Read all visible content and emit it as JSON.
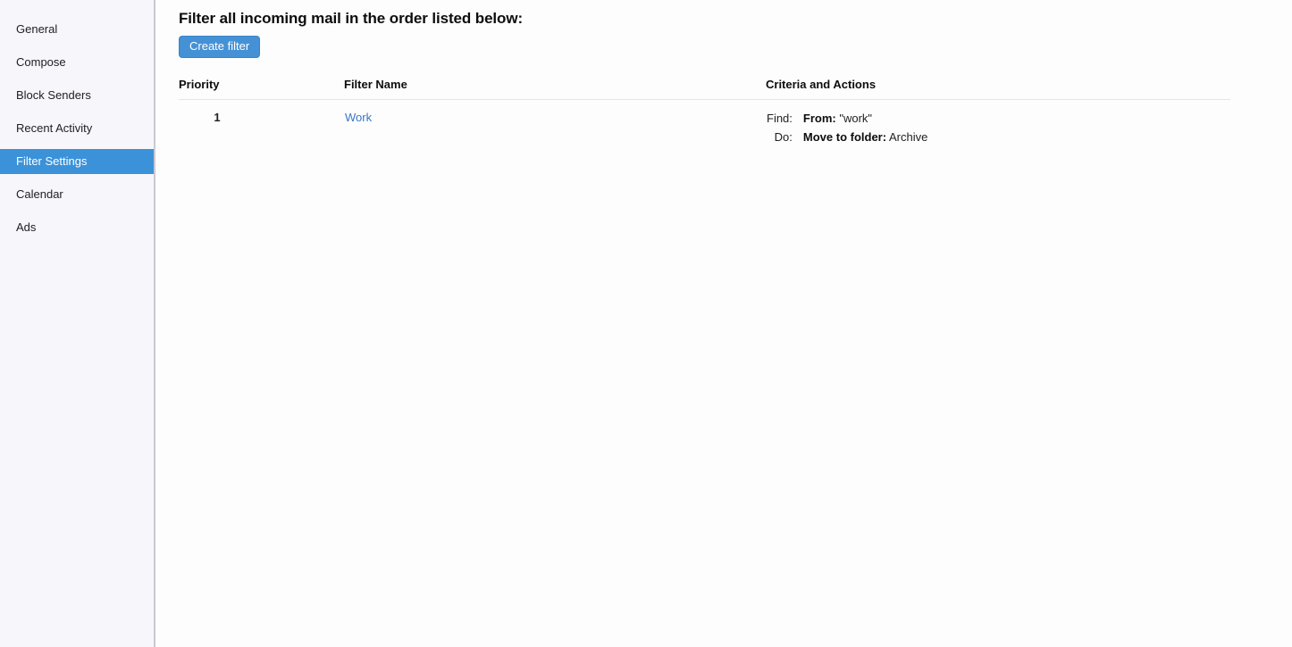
{
  "sidebar": {
    "items": [
      {
        "label": "General",
        "selected": false
      },
      {
        "label": "Compose",
        "selected": false
      },
      {
        "label": "Block Senders",
        "selected": false
      },
      {
        "label": "Recent Activity",
        "selected": false
      },
      {
        "label": "Filter Settings",
        "selected": true
      },
      {
        "label": "Calendar",
        "selected": false
      },
      {
        "label": "Ads",
        "selected": false
      }
    ]
  },
  "main": {
    "title": "Filter all incoming mail in the order listed below:",
    "create_filter_label": "Create filter",
    "table": {
      "headers": {
        "priority": "Priority",
        "filter_name": "Filter Name",
        "criteria_and_actions": "Criteria and Actions"
      },
      "rows": [
        {
          "priority": "1",
          "filter_name": "Work",
          "criteria": {
            "find_label": "Find:",
            "find_field": "From:",
            "find_value": "\"work\"",
            "do_label": "Do:",
            "do_action": "Move to folder:",
            "do_value": "Archive"
          }
        }
      ]
    }
  },
  "colors": {
    "accent_blue": "#3b92d8",
    "button_blue": "#4591d6",
    "link_blue": "#3a76c4",
    "sidebar_bg": "#f7f6fa",
    "content_bg": "#fdfdfd"
  }
}
